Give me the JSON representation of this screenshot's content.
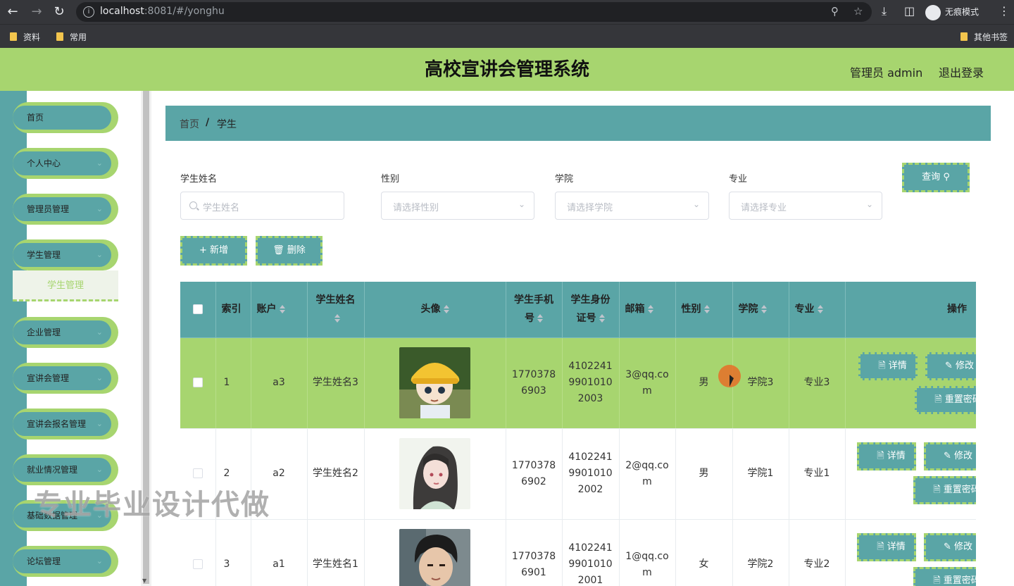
{
  "browser": {
    "url_host": "localhost",
    "url_rest": ":8081/#/yonghu",
    "incognito_label": "无痕模式",
    "bookmarks": [
      "资料",
      "常用"
    ],
    "other_bookmarks": "其他书签"
  },
  "header": {
    "title": "高校宣讲会管理系统",
    "user": "管理员 admin",
    "logout": "退出登录"
  },
  "sidebar": {
    "items": [
      {
        "label": "首页",
        "has_chevron": false
      },
      {
        "label": "个人中心",
        "has_chevron": true
      },
      {
        "label": "管理员管理",
        "has_chevron": true
      },
      {
        "label": "学生管理",
        "has_chevron": true
      },
      {
        "label": "企业管理",
        "has_chevron": true
      },
      {
        "label": "宣讲会管理",
        "has_chevron": true
      },
      {
        "label": "宣讲会报名管理",
        "has_chevron": true
      },
      {
        "label": "就业情况管理",
        "has_chevron": true
      },
      {
        "label": "基础数据管理",
        "has_chevron": true
      },
      {
        "label": "论坛管理",
        "has_chevron": true
      }
    ],
    "active_sub": "学生管理"
  },
  "breadcrumb": {
    "home": "首页",
    "separator": "/",
    "current": "学生"
  },
  "search": {
    "name_label": "学生姓名",
    "name_placeholder": "学生姓名",
    "gender_label": "性别",
    "gender_placeholder": "请选择性别",
    "college_label": "学院",
    "college_placeholder": "请选择学院",
    "major_label": "专业",
    "major_placeholder": "请选择专业",
    "query_button": "查询"
  },
  "actions": {
    "add": "新增",
    "delete": "删除"
  },
  "table": {
    "headers": {
      "index": "索引",
      "account": "账户",
      "name": "学生姓名",
      "avatar": "头像",
      "phone": "学生手机号",
      "id_card": "学生身份证号",
      "email": "邮箱",
      "gender": "性别",
      "college": "学院",
      "major": "专业",
      "actions": "操作"
    },
    "rows": [
      {
        "index": "1",
        "account": "a3",
        "name": "学生姓名3",
        "phone": "17703786903",
        "id_card": "410224199010102003",
        "email": "3@qq.com",
        "gender": "男",
        "college": "学院3",
        "major": "专业3"
      },
      {
        "index": "2",
        "account": "a2",
        "name": "学生姓名2",
        "phone": "17703786902",
        "id_card": "410224199010102002",
        "email": "2@qq.com",
        "gender": "男",
        "college": "学院1",
        "major": "专业1"
      },
      {
        "index": "3",
        "account": "a1",
        "name": "学生姓名1",
        "phone": "17703786901",
        "id_card": "410224199010102001",
        "email": "1@qq.com",
        "gender": "女",
        "college": "学院2",
        "major": "专业2"
      }
    ],
    "row_actions": {
      "detail": "详情",
      "edit": "修改",
      "reset": "重置密码"
    }
  },
  "watermark": "专业毕业设计代做",
  "colors": {
    "primary_green": "#a7d56f",
    "teal": "#5aa5a6"
  }
}
